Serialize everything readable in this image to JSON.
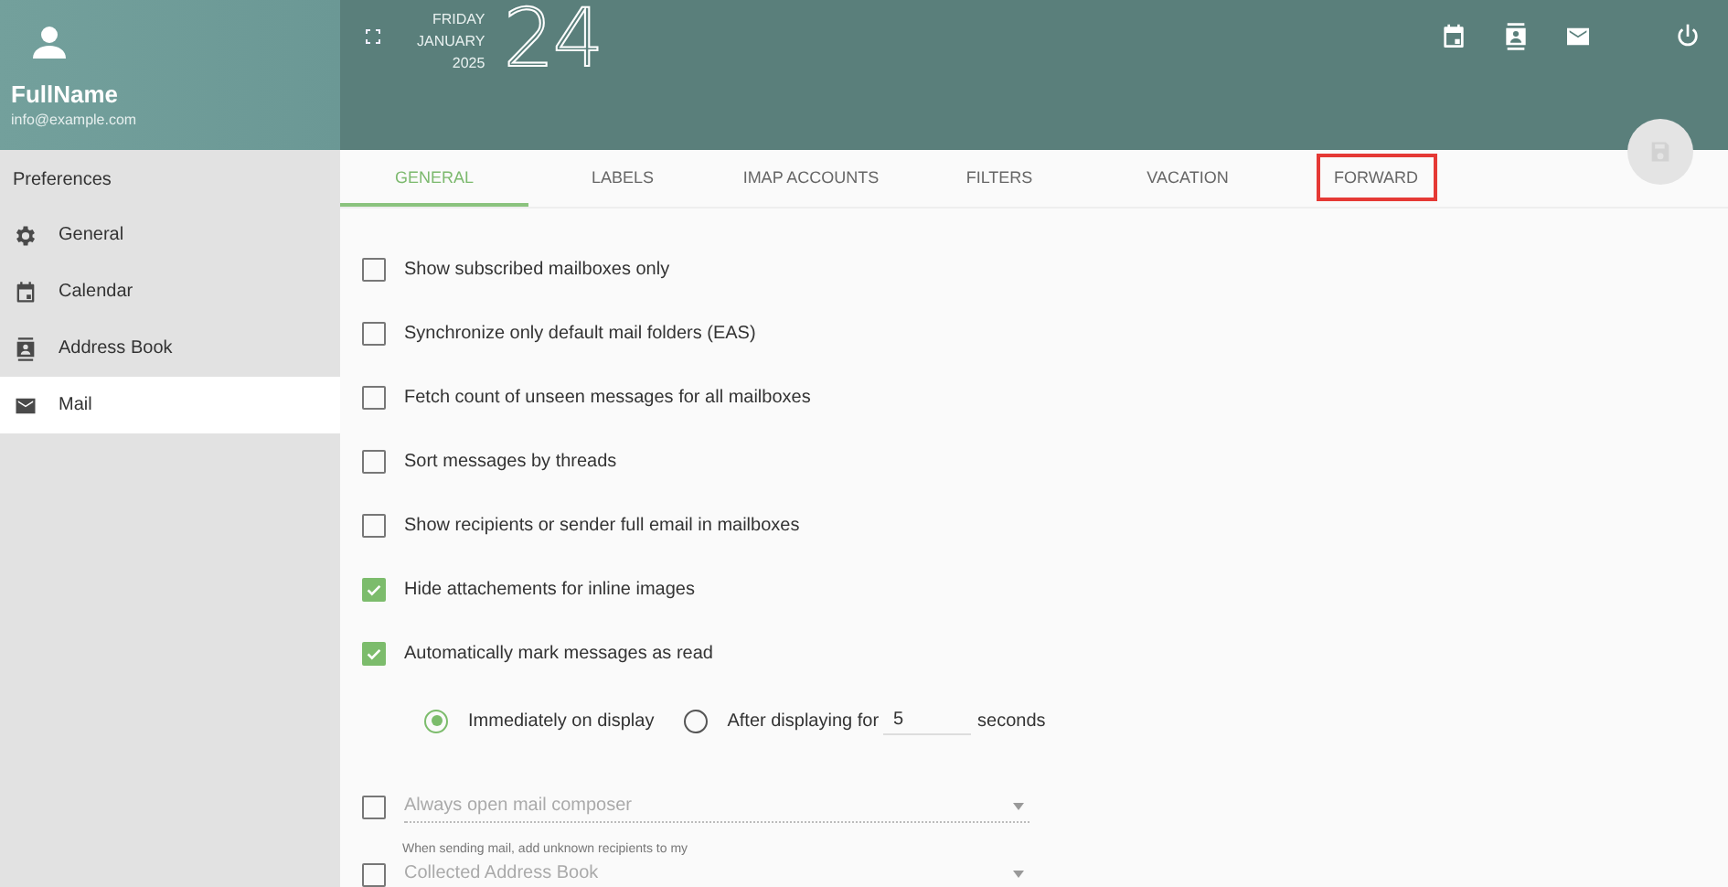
{
  "user": {
    "name": "FullName",
    "email": "info@example.com"
  },
  "date": {
    "weekday": "FRIDAY",
    "month": "JANUARY",
    "year": "2025",
    "day": "24"
  },
  "sidebar": {
    "title": "Preferences",
    "items": [
      {
        "label": "General",
        "selected": false
      },
      {
        "label": "Calendar",
        "selected": false
      },
      {
        "label": "Address Book",
        "selected": false
      },
      {
        "label": "Mail",
        "selected": true
      }
    ]
  },
  "tabs": [
    {
      "label": "GENERAL",
      "selected": true,
      "highlighted": false
    },
    {
      "label": "LABELS",
      "selected": false,
      "highlighted": false
    },
    {
      "label": "IMAP ACCOUNTS",
      "selected": false,
      "highlighted": false
    },
    {
      "label": "FILTERS",
      "selected": false,
      "highlighted": false
    },
    {
      "label": "VACATION",
      "selected": false,
      "highlighted": false
    },
    {
      "label": "FORWARD",
      "selected": false,
      "highlighted": true
    }
  ],
  "options": [
    {
      "label": "Show subscribed mailboxes only",
      "checked": false
    },
    {
      "label": "Synchronize only default mail folders (EAS)",
      "checked": false
    },
    {
      "label": "Fetch count of unseen messages for all mailboxes",
      "checked": false
    },
    {
      "label": "Sort messages by threads",
      "checked": false
    },
    {
      "label": "Show recipients or sender full email in mailboxes",
      "checked": false
    },
    {
      "label": "Hide attachements for inline images",
      "checked": true
    },
    {
      "label": "Automatically mark messages as read",
      "checked": true
    }
  ],
  "read_mode": {
    "choices": [
      {
        "label": "Immediately on display",
        "selected": true
      },
      {
        "label": "After displaying for",
        "selected": false
      }
    ],
    "delay": "5",
    "unit": "seconds"
  },
  "composer": {
    "checked": false,
    "placeholder": "Always open mail composer"
  },
  "recipients": {
    "checked": false,
    "caption": "When sending mail, add unknown recipients to my",
    "value": "Collected Address Book"
  }
}
